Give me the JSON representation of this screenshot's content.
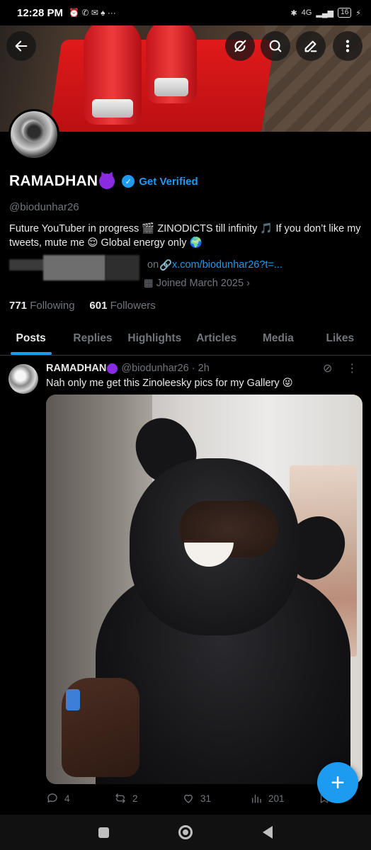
{
  "status_bar": {
    "time": "12:28 PM",
    "network": "4G",
    "battery": "16"
  },
  "header": {
    "back_icon": "arrow-left-icon",
    "actions": [
      "grok-icon",
      "search-icon",
      "edit-icon",
      "more-vertical-icon"
    ]
  },
  "profile": {
    "name": "RAMADHAN",
    "get_verified": "Get Verified",
    "handle": "@biodunhar26",
    "bio": "Future YouTuber in progress 🎬 ZINODICTS till infinity 🎵 If you don’t like my tweets, mute me 😌 Global energy only 🌍",
    "meta_on": "on",
    "link": "x.com/biodunhar26?t=...",
    "joined": "Joined March 2025",
    "following_count": "771",
    "following_label": "Following",
    "followers_count": "601",
    "followers_label": "Followers"
  },
  "tabs": [
    "Posts",
    "Replies",
    "Highlights",
    "Articles",
    "Media",
    "Likes"
  ],
  "tweet": {
    "name": "RAMADHAN",
    "handle_time": "@biodunhar26 · 2h",
    "text": "Nah only me get this Zinoleesky pics for my Gallery 😜",
    "replies": "4",
    "retweets": "2",
    "likes": "31",
    "views": "201"
  },
  "fab_label": "+",
  "colors": {
    "accent": "#1d9bf0",
    "background": "#000000",
    "muted": "#71767b"
  }
}
